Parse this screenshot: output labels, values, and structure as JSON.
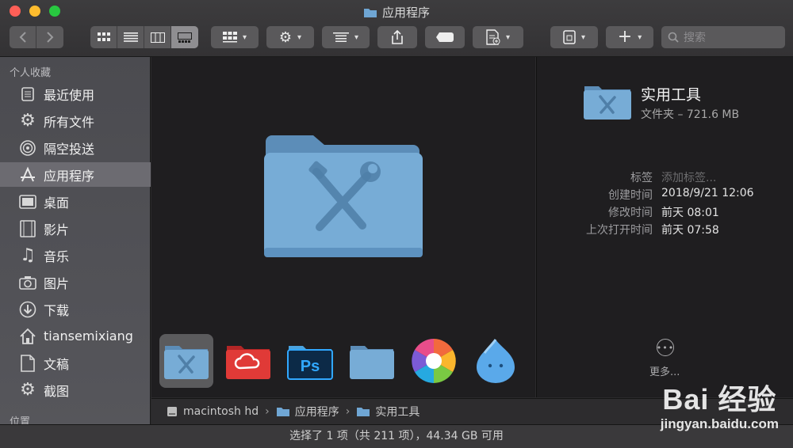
{
  "window": {
    "title": "应用程序"
  },
  "toolbar": {
    "back": "back",
    "forward": "forward",
    "view_modes": [
      "icon-view",
      "list-view",
      "column-view",
      "gallery-view"
    ],
    "active_view": "gallery-view",
    "search_placeholder": "搜索"
  },
  "sidebar": {
    "favorites_header": "个人收藏",
    "locations_header": "位置",
    "items": [
      {
        "label": "最近使用",
        "icon": "recents-icon"
      },
      {
        "label": "所有文件",
        "icon": "gear-icon"
      },
      {
        "label": "隔空投送",
        "icon": "airdrop-icon"
      },
      {
        "label": "应用程序",
        "icon": "applications-icon",
        "selected": true
      },
      {
        "label": "桌面",
        "icon": "desktop-icon"
      },
      {
        "label": "影片",
        "icon": "movies-icon"
      },
      {
        "label": "音乐",
        "icon": "music-icon"
      },
      {
        "label": "图片",
        "icon": "camera-icon"
      },
      {
        "label": "下载",
        "icon": "download-icon"
      },
      {
        "label": "tiansemixiang",
        "icon": "home-icon"
      },
      {
        "label": "文稿",
        "icon": "documents-icon"
      },
      {
        "label": "截图",
        "icon": "gear-icon"
      }
    ]
  },
  "preview": {
    "thumbnails": [
      {
        "name": "utilities-folder-icon",
        "selected": true
      },
      {
        "name": "adobe-creative-cloud-folder-icon"
      },
      {
        "name": "photoshop-folder-icon"
      },
      {
        "name": "plain-folder-icon"
      },
      {
        "name": "colorful-pinwheel-app-icon"
      },
      {
        "name": "blue-droplet-app-icon"
      }
    ]
  },
  "info": {
    "name": "实用工具",
    "kind_size": "文件夹 – 721.6 MB",
    "rows": [
      {
        "key": "标签",
        "value": "添加标签...",
        "placeholder": true
      },
      {
        "key": "创建时间",
        "value": "2018/9/21 12:06"
      },
      {
        "key": "修改时间",
        "value": "前天 08:01"
      },
      {
        "key": "上次打开时间",
        "value": "前天 07:58"
      }
    ],
    "more_label": "更多..."
  },
  "pathbar": {
    "crumbs": [
      {
        "label": "macintosh hd",
        "icon": "disk-icon"
      },
      {
        "label": "应用程序",
        "icon": "folder-icon"
      },
      {
        "label": "实用工具",
        "icon": "folder-icon"
      }
    ]
  },
  "status": {
    "text": "选择了 1 项（共 211 项），44.34 GB 可用"
  },
  "watermark": {
    "brand": "Bai 经验",
    "url": "jingyan.baidu.com"
  },
  "colors": {
    "accent_folder": "#6fa6d4",
    "selection": "#6c6b71"
  }
}
